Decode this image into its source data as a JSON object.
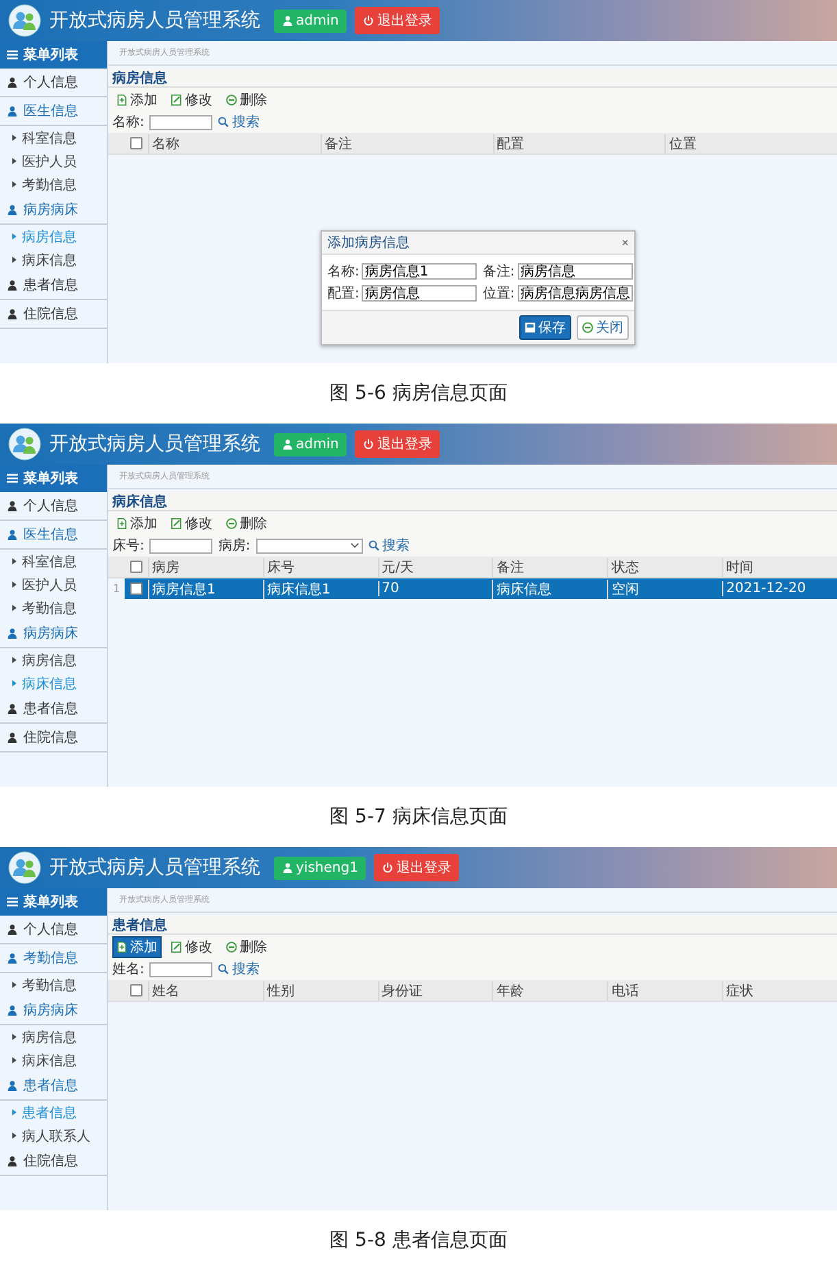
{
  "screens": [
    {
      "header": {
        "title": "开放式病房人员管理系统",
        "user": "admin",
        "logout": "退出登录"
      },
      "sidebar": {
        "title": "菜单列表",
        "items": [
          {
            "label": "个人信息",
            "expanded": false
          },
          {
            "label": "医生信息",
            "expanded": true,
            "children": [
              {
                "label": "科室信息",
                "selected": false
              },
              {
                "label": "医护人员",
                "selected": false
              },
              {
                "label": "考勤信息",
                "selected": false
              }
            ]
          },
          {
            "label": "病房病床",
            "expanded": true,
            "children": [
              {
                "label": "病房信息",
                "selected": true
              },
              {
                "label": "病床信息",
                "selected": false
              }
            ]
          },
          {
            "label": "患者信息",
            "expanded": false
          },
          {
            "label": "住院信息",
            "expanded": false
          }
        ]
      },
      "breadcrumb": "开放式病房人员管理系统",
      "panel": {
        "title": "病房信息",
        "toolbar": [
          {
            "label": "添加",
            "kind": "add",
            "highlighted": false
          },
          {
            "label": "修改",
            "kind": "edit",
            "highlighted": false
          },
          {
            "label": "删除",
            "kind": "remove",
            "highlighted": false
          }
        ],
        "filters": [
          {
            "label": "名称:",
            "kind": "text"
          }
        ],
        "search": "搜索",
        "table": {
          "columns": [
            "名称",
            "备注",
            "配置",
            "位置"
          ],
          "all_checked": false
        }
      },
      "dialog": {
        "title": "添加病房信息",
        "close": "×",
        "fields": [
          {
            "label": "名称:",
            "value": "病房信息1"
          },
          {
            "label": "备注:",
            "value": "病房信息"
          },
          {
            "label": "配置:",
            "value": "病房信息"
          },
          {
            "label": "位置:",
            "value": "病房信息病房信息"
          }
        ],
        "buttons": [
          {
            "label": "保存",
            "kind": "save"
          },
          {
            "label": "关闭",
            "kind": "close"
          }
        ]
      },
      "caption": "图 5-6 病房信息页面"
    },
    {
      "header": {
        "title": "开放式病房人员管理系统",
        "user": "admin",
        "logout": "退出登录"
      },
      "sidebar": {
        "title": "菜单列表",
        "items": [
          {
            "label": "个人信息",
            "expanded": false
          },
          {
            "label": "医生信息",
            "expanded": true,
            "children": [
              {
                "label": "科室信息",
                "selected": false
              },
              {
                "label": "医护人员",
                "selected": false
              },
              {
                "label": "考勤信息",
                "selected": false
              }
            ]
          },
          {
            "label": "病房病床",
            "expanded": true,
            "children": [
              {
                "label": "病房信息",
                "selected": false
              },
              {
                "label": "病床信息",
                "selected": true
              }
            ]
          },
          {
            "label": "患者信息",
            "expanded": false
          },
          {
            "label": "住院信息",
            "expanded": false
          }
        ]
      },
      "breadcrumb": "开放式病房人员管理系统",
      "panel": {
        "title": "病床信息",
        "toolbar": [
          {
            "label": "添加",
            "kind": "add",
            "highlighted": false
          },
          {
            "label": "修改",
            "kind": "edit",
            "highlighted": false
          },
          {
            "label": "删除",
            "kind": "remove",
            "highlighted": false
          }
        ],
        "filters": [
          {
            "label": "床号:",
            "kind": "text"
          },
          {
            "label": "病房:",
            "kind": "select"
          }
        ],
        "search": "搜索",
        "table": {
          "columns": [
            "病房",
            "床号",
            "元/天",
            "备注",
            "状态",
            "时间"
          ],
          "all_checked": false,
          "rows": [
            {
              "number": "1",
              "selected": true,
              "checked": false,
              "cells": [
                "病房信息1",
                "病床信息1",
                "70",
                "病床信息",
                "空闲",
                "2021-12-20"
              ]
            }
          ]
        }
      },
      "caption": "图 5-7 病床信息页面"
    },
    {
      "header": {
        "title": "开放式病房人员管理系统",
        "user": "yisheng1",
        "logout": "退出登录"
      },
      "sidebar": {
        "title": "菜单列表",
        "items": [
          {
            "label": "个人信息",
            "expanded": false
          },
          {
            "label": "考勤信息",
            "expanded": true,
            "children": [
              {
                "label": "考勤信息",
                "selected": false
              }
            ]
          },
          {
            "label": "病房病床",
            "expanded": true,
            "children": [
              {
                "label": "病房信息",
                "selected": false
              },
              {
                "label": "病床信息",
                "selected": false
              }
            ]
          },
          {
            "label": "患者信息",
            "expanded": true,
            "children": [
              {
                "label": "患者信息",
                "selected": true
              },
              {
                "label": "病人联系人",
                "selected": false
              }
            ]
          },
          {
            "label": "住院信息",
            "expanded": false
          }
        ]
      },
      "breadcrumb": "开放式病房人员管理系统",
      "panel": {
        "title": "患者信息",
        "toolbar": [
          {
            "label": "添加",
            "kind": "add",
            "highlighted": true
          },
          {
            "label": "修改",
            "kind": "edit",
            "highlighted": false
          },
          {
            "label": "删除",
            "kind": "remove",
            "highlighted": false
          }
        ],
        "filters": [
          {
            "label": "姓名:",
            "kind": "text"
          }
        ],
        "search": "搜索",
        "table": {
          "columns": [
            "姓名",
            "性别",
            "身份证",
            "年龄",
            "电话",
            "症状"
          ],
          "all_checked": false
        }
      },
      "caption": "图 5-8 患者信息页面"
    }
  ]
}
